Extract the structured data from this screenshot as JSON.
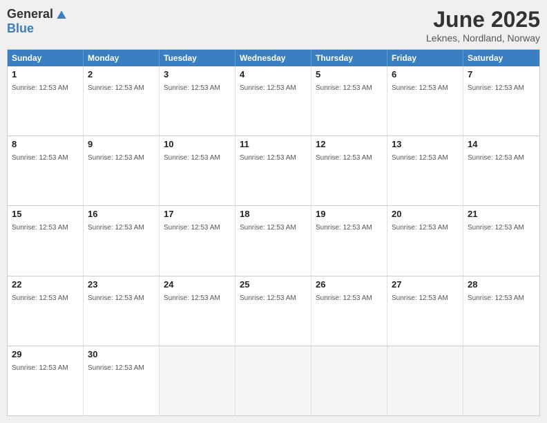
{
  "logo": {
    "general": "General",
    "blue": "Blue"
  },
  "title": "June 2025",
  "location": "Leknes, Nordland, Norway",
  "days": [
    "Sunday",
    "Monday",
    "Tuesday",
    "Wednesday",
    "Thursday",
    "Friday",
    "Saturday"
  ],
  "sunrise": "Sunrise: 12:53 AM",
  "weeks": [
    [
      {
        "date": "1",
        "sunrise": "Sunrise: 12:53 AM"
      },
      {
        "date": "2",
        "sunrise": "Sunrise: 12:53 AM"
      },
      {
        "date": "3",
        "sunrise": "Sunrise: 12:53 AM"
      },
      {
        "date": "4",
        "sunrise": "Sunrise: 12:53 AM"
      },
      {
        "date": "5",
        "sunrise": "Sunrise: 12:53 AM"
      },
      {
        "date": "6",
        "sunrise": "Sunrise: 12:53 AM"
      },
      {
        "date": "7",
        "sunrise": "Sunrise: 12:53 AM"
      }
    ],
    [
      {
        "date": "8",
        "sunrise": "Sunrise: 12:53 AM"
      },
      {
        "date": "9",
        "sunrise": "Sunrise: 12:53 AM"
      },
      {
        "date": "10",
        "sunrise": "Sunrise: 12:53 AM"
      },
      {
        "date": "11",
        "sunrise": "Sunrise: 12:53 AM"
      },
      {
        "date": "12",
        "sunrise": "Sunrise: 12:53 AM"
      },
      {
        "date": "13",
        "sunrise": "Sunrise: 12:53 AM"
      },
      {
        "date": "14",
        "sunrise": "Sunrise: 12:53 AM"
      }
    ],
    [
      {
        "date": "15",
        "sunrise": "Sunrise: 12:53 AM"
      },
      {
        "date": "16",
        "sunrise": "Sunrise: 12:53 AM"
      },
      {
        "date": "17",
        "sunrise": "Sunrise: 12:53 AM"
      },
      {
        "date": "18",
        "sunrise": "Sunrise: 12:53 AM"
      },
      {
        "date": "19",
        "sunrise": "Sunrise: 12:53 AM"
      },
      {
        "date": "20",
        "sunrise": "Sunrise: 12:53 AM"
      },
      {
        "date": "21",
        "sunrise": "Sunrise: 12:53 AM"
      }
    ],
    [
      {
        "date": "22",
        "sunrise": "Sunrise: 12:53 AM"
      },
      {
        "date": "23",
        "sunrise": "Sunrise: 12:53 AM"
      },
      {
        "date": "24",
        "sunrise": "Sunrise: 12:53 AM"
      },
      {
        "date": "25",
        "sunrise": "Sunrise: 12:53 AM"
      },
      {
        "date": "26",
        "sunrise": "Sunrise: 12:53 AM"
      },
      {
        "date": "27",
        "sunrise": "Sunrise: 12:53 AM"
      },
      {
        "date": "28",
        "sunrise": "Sunrise: 12:53 AM"
      }
    ],
    [
      {
        "date": "29",
        "sunrise": "Sunrise: 12:53 AM"
      },
      {
        "date": "30",
        "sunrise": "Sunrise: 12:53 AM"
      },
      {
        "date": "",
        "sunrise": ""
      },
      {
        "date": "",
        "sunrise": ""
      },
      {
        "date": "",
        "sunrise": ""
      },
      {
        "date": "",
        "sunrise": ""
      },
      {
        "date": "",
        "sunrise": ""
      }
    ]
  ]
}
